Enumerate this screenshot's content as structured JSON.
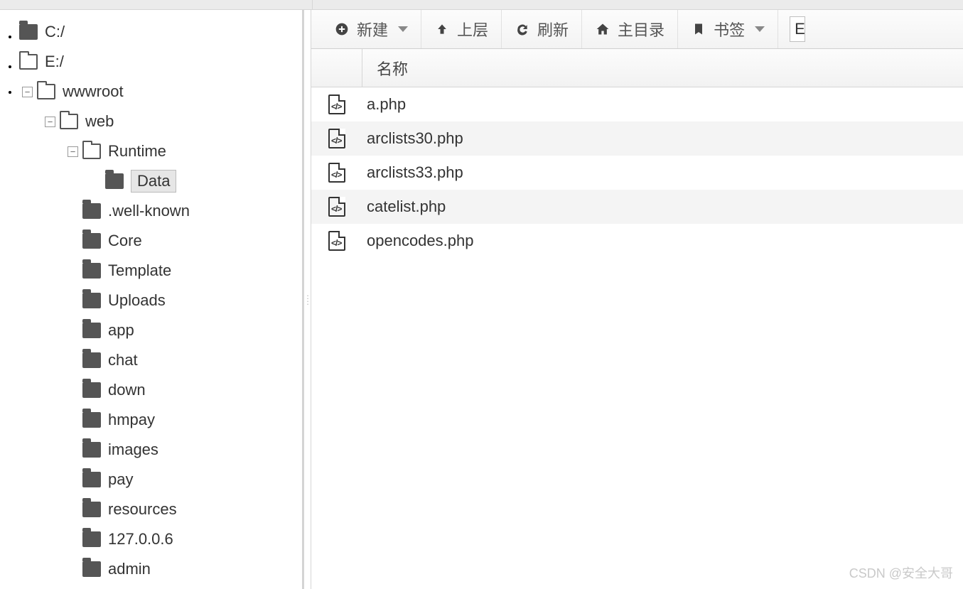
{
  "toolbar": {
    "new": "新建",
    "up": "上层",
    "refresh": "刷新",
    "home": "主目录",
    "bookmark": "书签",
    "path_preview": "E"
  },
  "table": {
    "header_name": "名称"
  },
  "files": [
    {
      "name": "a.php"
    },
    {
      "name": "arclists30.php"
    },
    {
      "name": "arclists33.php"
    },
    {
      "name": "catelist.php"
    },
    {
      "name": "opencodes.php"
    }
  ],
  "tree": {
    "drives": [
      {
        "label": "C:/",
        "icon": "solid"
      },
      {
        "label": "E:/",
        "icon": "open"
      }
    ],
    "wwwroot": "wwwroot",
    "web": "web",
    "runtime": "Runtime",
    "data": "Data",
    "web_children": [
      ".well-known",
      "Core",
      "Template",
      "Uploads",
      "app",
      "chat",
      "down",
      "hmpay",
      "images",
      "pay",
      "resources"
    ],
    "wwwroot_siblings": [
      "127.0.0.6",
      "admin"
    ]
  },
  "watermark": "CSDN @安全大哥"
}
